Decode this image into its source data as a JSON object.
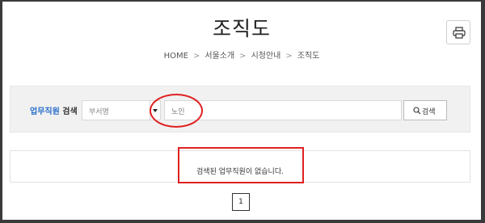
{
  "page": {
    "title": "조직도",
    "print_icon": "printer-icon"
  },
  "breadcrumb": {
    "items": [
      "HOME",
      "서울소개",
      "시청안내",
      "조직도"
    ],
    "separator": ">"
  },
  "search": {
    "label_accent": "업무직원",
    "label_rest": " 검색",
    "dept_placeholder": "부서명",
    "name_value": "노인",
    "button_label": "검색",
    "button_icon": "search-icon"
  },
  "result": {
    "message": "검색된 업무직원이 없습니다."
  },
  "pagination": {
    "current": "1"
  },
  "colors": {
    "accent": "#2a6fc9",
    "annotation": "#e02020"
  }
}
